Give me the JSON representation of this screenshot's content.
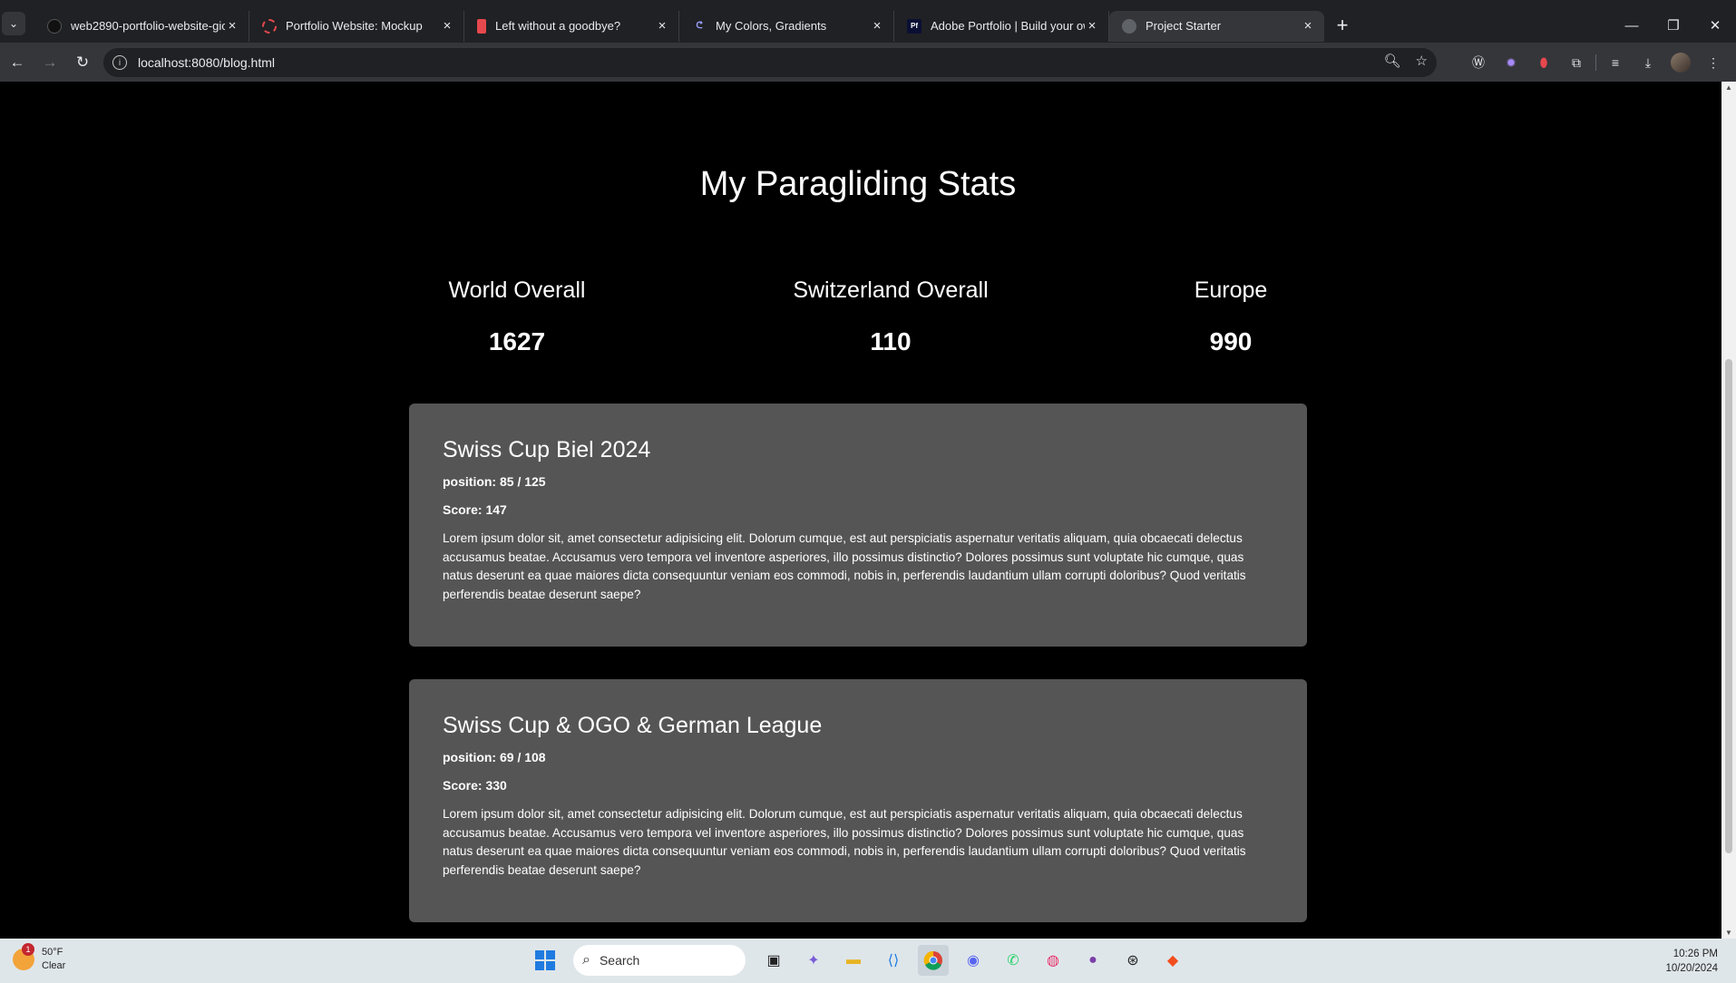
{
  "browser": {
    "tabs": [
      {
        "title": "web2890-portfolio-website-gio",
        "icon": "github-icon"
      },
      {
        "title": "Portfolio Website: Mockup",
        "icon": "circle-icon"
      },
      {
        "title": "Left without a goodbye?",
        "icon": "bookmark-icon"
      },
      {
        "title": "My Colors, Gradients",
        "icon": "gradient-icon"
      },
      {
        "title": "Adobe Portfolio | Build your ow",
        "icon": "pf-icon"
      },
      {
        "title": "Project Starter",
        "icon": "globe-icon"
      }
    ],
    "active_tab": 5,
    "url": "localhost:8080/blog.html"
  },
  "page": {
    "title": "My Paragliding Stats",
    "stats": [
      {
        "label": "World Overall",
        "value": "1627"
      },
      {
        "label": "Switzerland Overall",
        "value": "110"
      },
      {
        "label": "Europe",
        "value": "990"
      }
    ],
    "cards": [
      {
        "title": "Swiss Cup Biel 2024",
        "position": "position: 85 / 125",
        "score": "Score: 147",
        "body": "Lorem ipsum dolor sit, amet consectetur adipisicing elit. Dolorum cumque, est aut perspiciatis aspernatur veritatis aliquam, quia obcaecati delectus accusamus beatae. Accusamus vero tempora vel inventore asperiores, illo possimus distinctio? Dolores possimus sunt voluptate hic cumque, quas natus deserunt ea quae maiores dicta consequuntur veniam eos commodi, nobis in, perferendis laudantium ullam corrupti doloribus? Quod veritatis perferendis beatae deserunt saepe?"
      },
      {
        "title": "Swiss Cup & OGO & German League",
        "position": "position: 69 / 108",
        "score": "Score: 330",
        "body": "Lorem ipsum dolor sit, amet consectetur adipisicing elit. Dolorum cumque, est aut perspiciatis aspernatur veritatis aliquam, quia obcaecati delectus accusamus beatae. Accusamus vero tempora vel inventore asperiores, illo possimus distinctio? Dolores possimus sunt voluptate hic cumque, quas natus deserunt ea quae maiores dicta consequuntur veniam eos commodi, nobis in, perferendis laudantium ullam corrupti doloribus? Quod veritatis perferendis beatae deserunt saepe?"
      }
    ]
  },
  "taskbar": {
    "weather_temp": "50°F",
    "weather_desc": "Clear",
    "weather_badge": "1",
    "search_placeholder": "Search",
    "time": "10:26 PM",
    "date": "10/20/2024"
  },
  "colors": {
    "page_bg": "#000000",
    "card_bg": "#555556",
    "text": "#ffffff"
  }
}
